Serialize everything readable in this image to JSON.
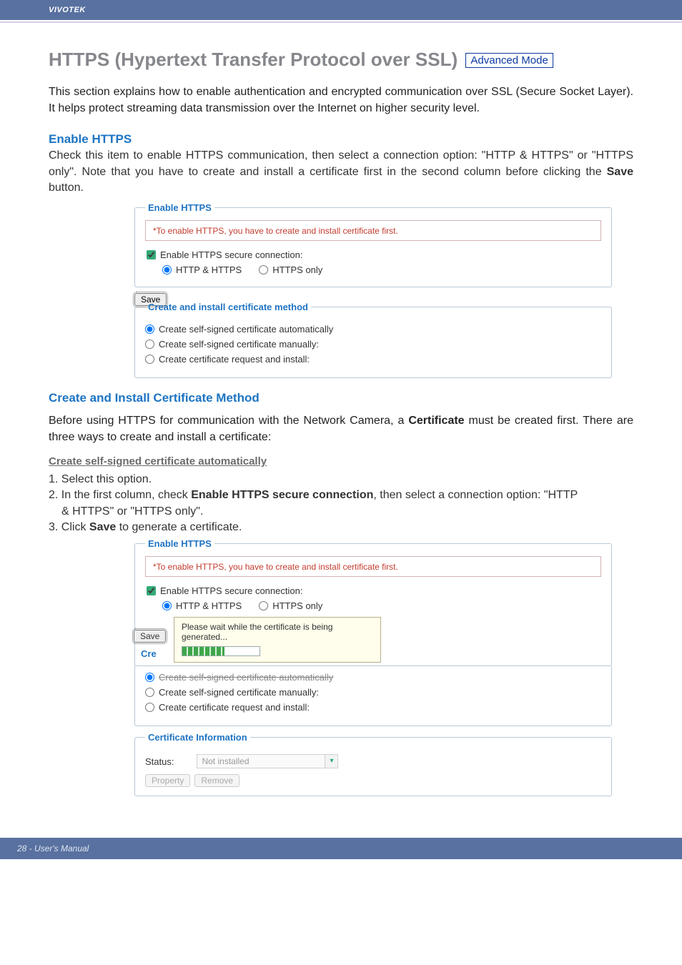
{
  "header": {
    "brand": "VIVOTEK"
  },
  "title": {
    "main": "HTTPS (Hypertext Transfer Protocol over SSL)",
    "badge": "Advanced Mode"
  },
  "intro": "This section explains how to enable authentication and encrypted communication over SSL (Secure Socket Layer). It helps protect streaming data transmission over the Internet on higher security level.",
  "enable_https": {
    "heading": "Enable HTTPS",
    "paragraph_before_word": "Check this item to enable HTTPS communication, then select a connection option: \"HTTP & HTTPS\" or \"HTTPS only\". Note that you have to create and install a certificate first in the second column before clicking the ",
    "paragraph_bold": "Save",
    "paragraph_after_word": " button."
  },
  "panel1": {
    "legend": "Enable HTTPS",
    "notice": "*To enable HTTPS, you have to create and install certificate first.",
    "checkbox_label": "Enable HTTPS secure connection:",
    "radio_a": "HTTP & HTTPS",
    "radio_b": "HTTPS only",
    "save_btn": "Save"
  },
  "panel2": {
    "legend": "Create and install certificate method",
    "opt1": "Create self-signed certificate automatically",
    "opt2": "Create self-signed certificate manually:",
    "opt3": "Create certificate request and install:"
  },
  "create_method": {
    "heading": "Create and Install Certificate Method",
    "paragraph_before": "Before using HTTPS for communication with the Network Camera, a ",
    "paragraph_bold": "Certificate",
    "paragraph_after": " must be created first. There are three ways to create and install a certificate:"
  },
  "cssca": {
    "sub": "Create self-signed certificate automatically",
    "li1": "1. Select this option.",
    "li2a": "2. In the first column, check ",
    "li2b": "Enable HTTPS secure connection",
    "li2c": ", then select a connection option: \"HTTP",
    "li2d": "& HTTPS\" or \"HTTPS only\".",
    "li3a": "3. Click ",
    "li3b": "Save",
    "li3c": " to generate a certificate."
  },
  "loading": {
    "save_btn": "Save",
    "cre_label": "Cre",
    "msg1": "Please wait while the certificate is being",
    "msg2": "generated...",
    "strike_opt": "Create self-signed certificate automatically"
  },
  "cert_info": {
    "legend": "Certificate Information",
    "status_label": "Status:",
    "status_value": "Not installed",
    "property_btn": "Property",
    "remove_btn": "Remove"
  },
  "footer": {
    "text": "28 - User's Manual"
  }
}
